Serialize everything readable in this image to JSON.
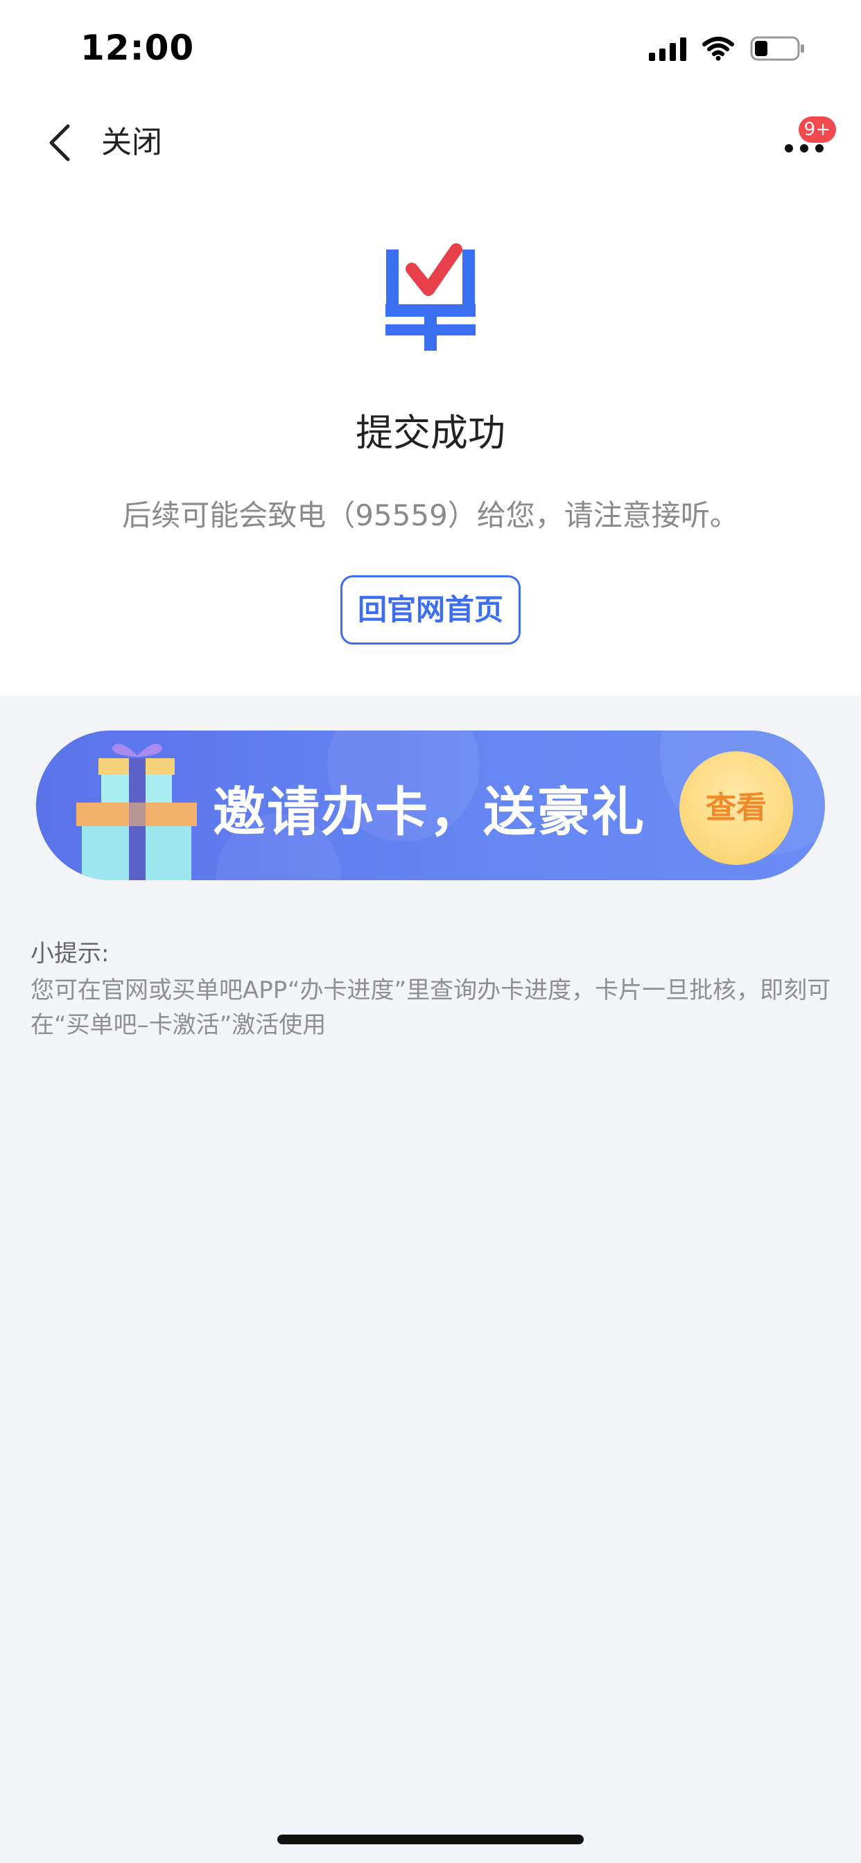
{
  "status_bar": {
    "time": "12:00",
    "icons": [
      "signal-icon",
      "wifi-icon",
      "battery-icon"
    ]
  },
  "nav": {
    "back_icon": "chevron-left-icon",
    "close_label": "关闭",
    "more_icon": "more-dots-icon",
    "badge": "9+"
  },
  "success": {
    "logo_icon": "bank-card-check-logo",
    "title": "提交成功",
    "description": "后续可能会致电（95559）给您，请注意接听。",
    "home_button_label": "回官网首页"
  },
  "banner": {
    "icon": "gift-icon",
    "text": "邀请办卡，送豪礼",
    "view_label": "查看"
  },
  "tips": {
    "label": "小提示:",
    "text": "您可在官网或买单吧APP“办卡进度”里查询办卡进度，卡片一旦批核，即刻可在“买单吧–卡激活”激活使用"
  },
  "colors": {
    "accent": "#3d6ef0",
    "badge": "#f2494f",
    "banner": "#6687f3",
    "view_button": "#fbd77a",
    "logo_check": "#e8404a"
  }
}
